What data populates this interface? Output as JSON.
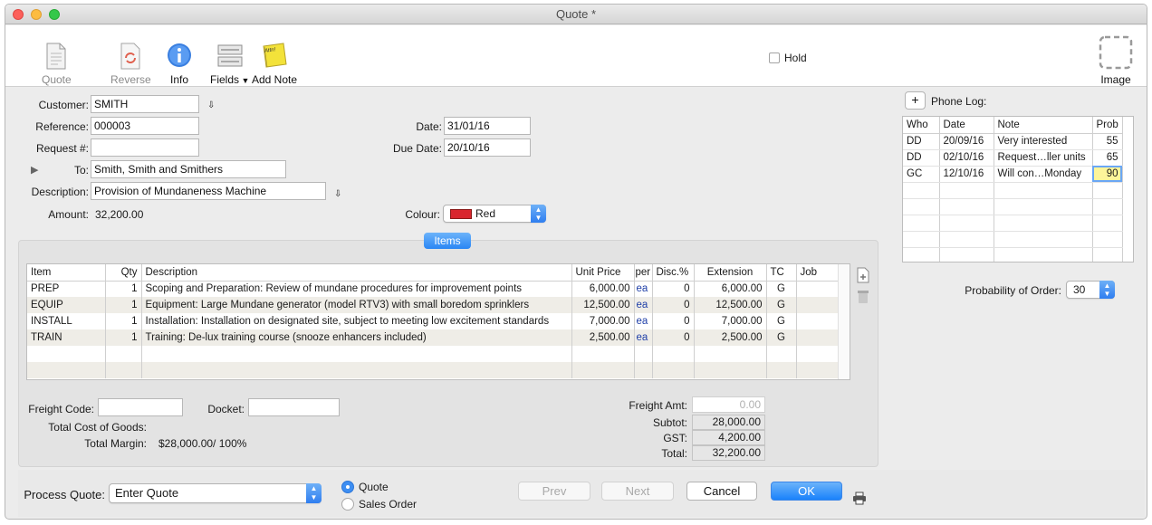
{
  "window": {
    "title": "Quote *"
  },
  "toolbar": {
    "quote": "Quote",
    "reverse": "Reverse",
    "info": "Info",
    "fields": "Fields",
    "add_note": "Add Note",
    "hold": "Hold",
    "image": "Image",
    "note_icon_text": "Attn!"
  },
  "form": {
    "customer_label": "Customer:",
    "customer": "SMITH",
    "reference_label": "Reference:",
    "reference": "000003",
    "request_label": "Request #:",
    "request": "",
    "to_label": "To:",
    "to": "Smith, Smith and Smithers",
    "description_label": "Description:",
    "description": "Provision of Mundaneness Machine",
    "amount_label": "Amount:",
    "amount": "32,200.00",
    "date_label": "Date:",
    "date": "31/01/16",
    "due_date_label": "Due Date:",
    "due_date": "20/10/16",
    "colour_label": "Colour:",
    "colour": "Red",
    "colour_swatch": "#d9262e"
  },
  "items": {
    "tab_label": "Items",
    "columns": [
      "Item",
      "Qty",
      "Description",
      "Unit Price",
      "per",
      "Disc.%",
      "Extension",
      "TC",
      "Job"
    ],
    "rows": [
      [
        "PREP",
        "1",
        "Scoping and Preparation: Review of mundane procedures for improvement points",
        "6,000.00",
        "ea",
        "0",
        "6,000.00",
        "G",
        ""
      ],
      [
        "EQUIP",
        "1",
        "Equipment: Large Mundane generator (model RTV3) with small boredom sprinklers",
        "12,500.00",
        "ea",
        "0",
        "12,500.00",
        "G",
        ""
      ],
      [
        "INSTALL",
        "1",
        "Installation: Installation on designated site, subject to meeting low excitement standards",
        "7,000.00",
        "ea",
        "0",
        "7,000.00",
        "G",
        ""
      ],
      [
        "TRAIN",
        "1",
        "Training: De-lux training course (snooze enhancers included)",
        "2,500.00",
        "ea",
        "0",
        "2,500.00",
        "G",
        ""
      ]
    ]
  },
  "footer": {
    "freight_code_label": "Freight Code:",
    "freight_code": "",
    "docket_label": "Docket:",
    "docket": "",
    "total_cost_label": "Total Cost of Goods:",
    "total_margin_label": "Total Margin:",
    "total_margin": "$28,000.00/ 100%",
    "freight_amt_label": "Freight Amt:",
    "freight_amt": "0.00",
    "subtot_label": "Subtot:",
    "subtot": "28,000.00",
    "gst_label": "GST:",
    "gst": "4,200.00",
    "total_label": "Total:",
    "total": "32,200.00"
  },
  "phone_log": {
    "add_label": "+",
    "title": "Phone Log:",
    "columns": [
      "Who",
      "Date",
      "Note",
      "Prob"
    ],
    "rows": [
      [
        "DD",
        "20/09/16",
        "Very interested",
        "55"
      ],
      [
        "DD",
        "02/10/16",
        "Request…ller units",
        "65"
      ],
      [
        "GC",
        "12/10/16",
        "Will con…Monday",
        "90"
      ]
    ]
  },
  "probability": {
    "label": "Probability of Order:",
    "value": "30"
  },
  "process": {
    "label": "Process Quote:",
    "value": "Enter Quote",
    "radio_quote": "Quote",
    "radio_sales_order": "Sales Order"
  },
  "buttons": {
    "prev": "Prev",
    "next": "Next",
    "cancel": "Cancel",
    "ok": "OK"
  }
}
